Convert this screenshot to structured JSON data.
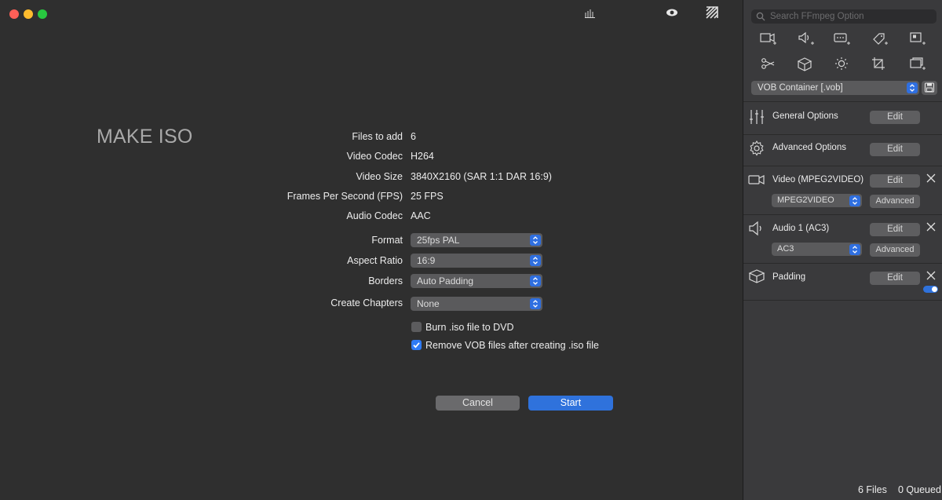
{
  "main": {
    "title": "MAKE ISO",
    "info": [
      {
        "label": "Files to add",
        "value": "6"
      },
      {
        "label": "Video Codec",
        "value": "H264"
      },
      {
        "label": "Video Size",
        "value": "3840X2160 (SAR 1:1 DAR 16:9)"
      },
      {
        "label": "Frames Per Second (FPS)",
        "value": "25 FPS"
      },
      {
        "label": "Audio Codec",
        "value": "AAC"
      }
    ],
    "selects": [
      {
        "label": "Format",
        "value": "25fps PAL"
      },
      {
        "label": "Aspect Ratio",
        "value": "16:9"
      },
      {
        "label": "Borders",
        "value": "Auto Padding"
      },
      {
        "label": "Create Chapters",
        "value": "None"
      }
    ],
    "checkboxes": [
      {
        "label": "Burn .iso file to DVD",
        "checked": false
      },
      {
        "label": "Remove VOB files after creating .iso file",
        "checked": true
      }
    ],
    "cancel_label": "Cancel",
    "start_label": "Start"
  },
  "toolbar": {
    "icons": [
      "bar-chart-icon",
      "eye-icon",
      "ffmpeg-logo-icon"
    ]
  },
  "sidebar": {
    "search_placeholder": "Search FFmpeg Option",
    "container": "VOB Container [.vob]",
    "rows": [
      {
        "label": "General Options",
        "edit": "Edit"
      },
      {
        "label": "Advanced Options",
        "edit": "Edit"
      },
      {
        "label": "Video (MPEG2VIDEO)",
        "edit": "Edit",
        "codec": "MPEG2VIDEO",
        "advanced": "Advanced"
      },
      {
        "label": "Audio 1 (AC3)",
        "edit": "Edit",
        "codec": "AC3",
        "advanced": "Advanced"
      },
      {
        "label": "Padding",
        "edit": "Edit"
      }
    ]
  },
  "status": {
    "files": "6 Files",
    "queued": "0 Queued"
  },
  "colors": {
    "accent": "#2f72dc",
    "bg_main": "#2f2f2f",
    "bg_sidebar": "#3a3a3c"
  }
}
